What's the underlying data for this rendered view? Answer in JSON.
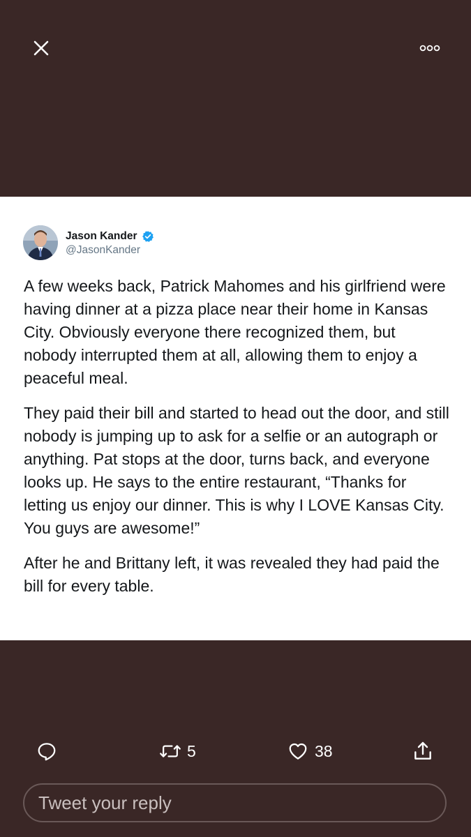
{
  "topbar": {
    "close_icon": "close-icon",
    "more_icon": "more-options-icon"
  },
  "tweet": {
    "author": {
      "display_name": "Jason Kander",
      "handle": "@JasonKander",
      "verified": true
    },
    "paragraphs": [
      "A few weeks back, Patrick Mahomes and his girlfriend were having dinner at a pizza place near their home in Kansas City. Obviously everyone there recognized them, but nobody interrupted them at all, allowing them to enjoy a peaceful meal.",
      "They paid their bill and started to head out the door, and still nobody is jumping up to ask for a selfie or an autograph or anything. Pat stops at the door, turns back, and everyone looks up. He says to the entire restaurant, “Thanks for letting us enjoy our dinner. This is why I LOVE Kansas City. You guys are awesome!”",
      "After he and Brittany left, it was revealed they had paid the bill for every table."
    ]
  },
  "actions": {
    "reply_icon": "reply-icon",
    "retweet_icon": "retweet-icon",
    "retweet_count": "5",
    "like_icon": "heart-icon",
    "like_count": "38",
    "share_icon": "share-icon"
  },
  "reply_box": {
    "placeholder": "Tweet your reply"
  },
  "colors": {
    "background": "#3a2726",
    "card": "#ffffff",
    "verified_blue": "#1da1f2",
    "text_primary": "#14171a",
    "text_secondary": "#657786"
  }
}
